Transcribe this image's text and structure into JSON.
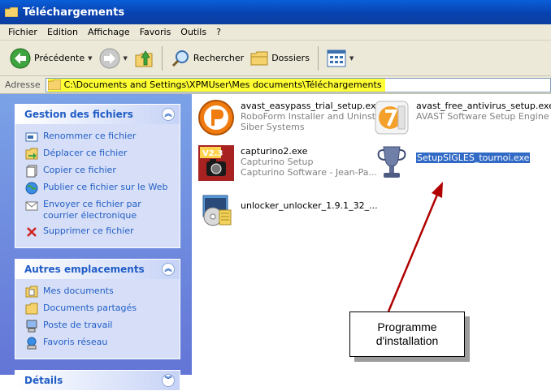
{
  "window": {
    "title": "Téléchargements"
  },
  "menu": [
    "Fichier",
    "Edition",
    "Affichage",
    "Favoris",
    "Outils",
    "?"
  ],
  "toolbar": {
    "back_label": "Précédente",
    "search_label": "Rechercher",
    "folders_label": "Dossiers"
  },
  "address": {
    "label": "Adresse",
    "path": "C:\\Documents and Settings\\XPMUser\\Mes documents\\Téléchargements"
  },
  "panels": {
    "file_tasks": {
      "title": "Gestion des fichiers",
      "items": [
        "Renommer ce fichier",
        "Déplacer ce fichier",
        "Copier ce fichier",
        "Publier ce fichier sur le Web",
        "Envoyer ce fichier par courrier électronique",
        "Supprimer ce fichier"
      ]
    },
    "other_places": {
      "title": "Autres emplacements",
      "items": [
        "Mes documents",
        "Documents partagés",
        "Poste de travail",
        "Favoris réseau"
      ]
    },
    "details": {
      "title": "Détails"
    }
  },
  "files": [
    {
      "name": "avast_easypass_trial_setup.exe",
      "line2": "RoboForm Installer and Uninst...",
      "line3": "Siber Systems",
      "icon": "roboform-icon"
    },
    {
      "name": "avast_free_antivirus_setup.exe",
      "line2": "AVAST Software Setup Engine",
      "line3": "",
      "icon": "avast-icon"
    },
    {
      "name": "capturino2.exe",
      "line2": "Capturino Setup",
      "line3": "Capturino Software - Jean-Pa...",
      "icon": "capturino-icon"
    },
    {
      "name": "SetupSIGLES_tournoi.exe",
      "line2": "",
      "line3": "",
      "icon": "trophy-icon",
      "selected": true
    },
    {
      "name": "unlocker_unlocker_1.9.1_32_...",
      "line2": "",
      "line3": "",
      "icon": "installer-icon"
    }
  ],
  "callout": {
    "line1": "Programme",
    "line2": "d'installation"
  },
  "colors": {
    "titlebar": "#0842b0",
    "link": "#215dc6",
    "highlight": "#ffff33",
    "selection": "#316ac5",
    "arrow": "#b00000"
  }
}
